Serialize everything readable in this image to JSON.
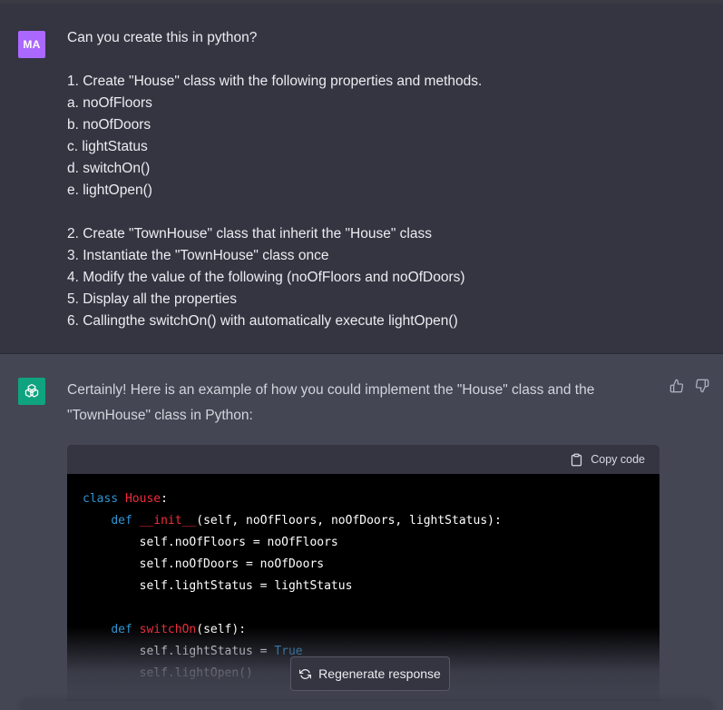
{
  "user": {
    "avatar_initials": "MA",
    "lines": [
      "Can you create this in python?",
      "",
      "1. Create \"House\" class with the following properties and methods.",
      "a. noOfFloors",
      "b. noOfDoors",
      "c. lightStatus",
      "d. switchOn()",
      "e. lightOpen()",
      "",
      "2. Create \"TownHouse\" class that inherit the \"House\" class",
      "3. Instantiate the \"TownHouse\" class once",
      "4. Modify the value of the following (noOfFloors and noOfDoors)",
      "5. Display all the properties",
      "6. Callingthe switchOn() with automatically execute lightOpen()"
    ]
  },
  "assistant": {
    "intro": "Certainly! Here is an example of how you could implement the \"House\" class and the \"TownHouse\" class in Python:",
    "copy_label": "Copy code",
    "code": {
      "l1_kw": "class",
      "l1_name": "House",
      "l1_rest": ":",
      "l2_indent": "    ",
      "l2_kw": "def",
      "l2_name": "__init__",
      "l2_rest": "(self, noOfFloors, noOfDoors, lightStatus):",
      "l3": "        self.noOfFloors = noOfFloors",
      "l4": "        self.noOfDoors = noOfDoors",
      "l5": "        self.lightStatus = lightStatus",
      "l6": "",
      "l7_indent": "    ",
      "l7_kw": "def",
      "l7_name": "switchOn",
      "l7_rest": "(self):",
      "l8_pre": "        self.lightStatus = ",
      "l8_kw": "True",
      "l9": "        self.lightOpen()"
    }
  },
  "regenerate_label": "Regenerate response",
  "colors": {
    "user_bg": "#343541",
    "assistant_bg": "#444654",
    "user_avatar": "#ab68ff",
    "gpt_avatar": "#10a37f",
    "keyword": "#2e95d3",
    "function_name": "#f22c3d"
  },
  "icons": {
    "thumbs_up": "thumbs-up-icon",
    "thumbs_down": "thumbs-down-icon",
    "clipboard": "clipboard-icon",
    "refresh": "refresh-icon",
    "openai_logo": "openai-logo-icon"
  }
}
